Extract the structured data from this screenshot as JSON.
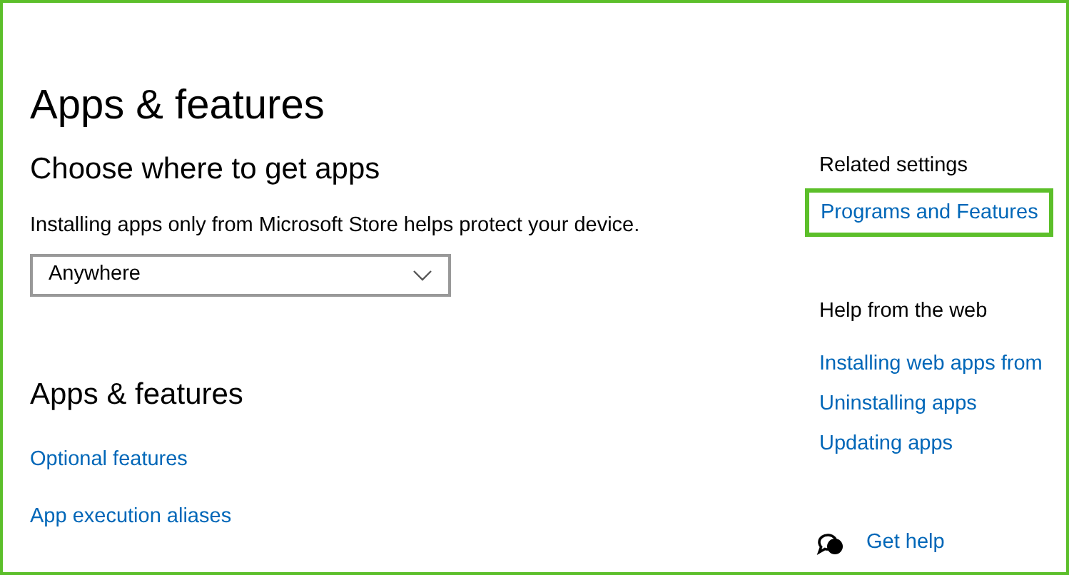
{
  "title": "Apps & features",
  "install_section": {
    "heading": "Choose where to get apps",
    "description": "Installing apps only from Microsoft Store helps protect your device.",
    "dropdown": {
      "value": "Anywhere"
    }
  },
  "apps_section": {
    "heading": "Apps & features",
    "links": [
      "Optional features",
      "App execution aliases"
    ]
  },
  "related_settings": {
    "heading": "Related settings",
    "links": [
      {
        "label": "Programs and Features",
        "highlighted": true
      }
    ]
  },
  "help_from_web": {
    "heading": "Help from the web",
    "links": [
      "Installing web apps from",
      "Uninstalling apps",
      "Updating apps"
    ]
  },
  "get_help": {
    "label": "Get help"
  }
}
